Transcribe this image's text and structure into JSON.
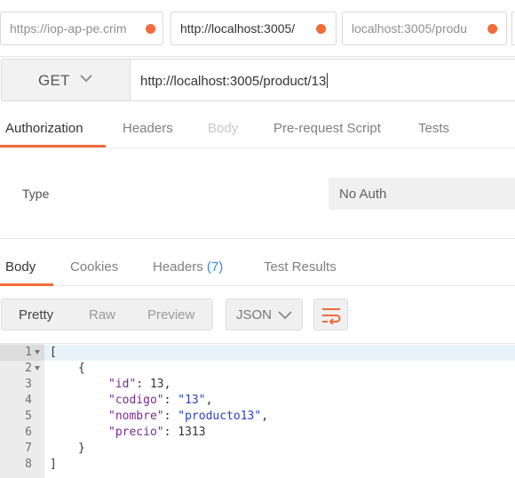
{
  "tabs": [
    {
      "title": "https://iop-ap-pe.crim",
      "active": false
    },
    {
      "title": "http://localhost:3005/",
      "active": true
    },
    {
      "title": "localhost:3005/produ",
      "active": false
    }
  ],
  "request": {
    "method": "GET",
    "url": "http://localhost:3005/product/13"
  },
  "request_tabs": {
    "authorization": "Authorization",
    "headers": "Headers",
    "body": "Body",
    "pre_request": "Pre-request Script",
    "tests": "Tests"
  },
  "auth": {
    "type_label": "Type",
    "type_value": "No Auth"
  },
  "response_tabs": {
    "body": "Body",
    "cookies": "Cookies",
    "headers": "Headers",
    "headers_count": "(7)",
    "test_results": "Test Results"
  },
  "toolbar": {
    "pretty": "Pretty",
    "raw": "Raw",
    "preview": "Preview",
    "format": "JSON"
  },
  "response_body": {
    "line_numbers": [
      "1",
      "2",
      "3",
      "4",
      "5",
      "6",
      "7",
      "8"
    ],
    "open_bracket": "[",
    "open_brace": "{",
    "fields": [
      {
        "key": "\"id\"",
        "value": "13",
        "kind": "num",
        "comma": ","
      },
      {
        "key": "\"codigo\"",
        "value": "\"13\"",
        "kind": "str",
        "comma": ","
      },
      {
        "key": "\"nombre\"",
        "value": "\"producto13\"",
        "kind": "str",
        "comma": ","
      },
      {
        "key": "\"precio\"",
        "value": "1313",
        "kind": "num",
        "comma": ""
      }
    ],
    "close_brace": "}",
    "close_bracket": "]"
  },
  "colors": {
    "accent": "#f26b3a",
    "link": "#3a8bd6"
  }
}
